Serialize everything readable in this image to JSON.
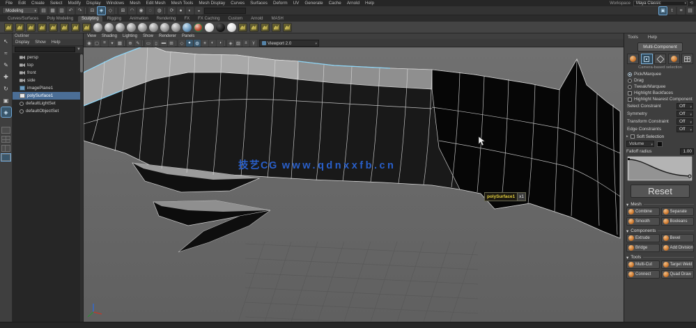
{
  "app": {
    "workspace_label": "Workspace",
    "workspace_value": "Maya Classic",
    "menu_set": "Modeling",
    "menus": [
      "File",
      "Edit",
      "Create",
      "Select",
      "Modify",
      "Display",
      "Windows",
      "Mesh",
      "Edit Mesh",
      "Mesh Tools",
      "Mesh Display",
      "Curves",
      "Surfaces",
      "Deform",
      "UV",
      "Generate",
      "Cache",
      "Arnold",
      "Help"
    ]
  },
  "statusline": {
    "icons": [
      {
        "icon_name": "new-scene-icon",
        "glyph": "▤"
      },
      {
        "icon_name": "open-scene-icon",
        "glyph": "▦"
      },
      {
        "icon_name": "save-scene-icon",
        "glyph": "▥"
      },
      {
        "icon_name": "undo-icon",
        "glyph": "↶"
      },
      {
        "icon_name": "redo-icon",
        "glyph": "↷"
      },
      {
        "type": "sep"
      },
      {
        "icon_name": "selection-mask-hierarchy-icon",
        "glyph": "⊟"
      },
      {
        "icon_name": "selection-mask-object-icon",
        "glyph": "◈",
        "active": true
      },
      {
        "icon_name": "selection-mask-component-icon",
        "glyph": "◇"
      },
      {
        "type": "sep"
      },
      {
        "icon_name": "snap-grid-icon",
        "glyph": "⊞"
      },
      {
        "icon_name": "snap-curve-icon",
        "glyph": "◠"
      },
      {
        "icon_name": "snap-point-icon",
        "glyph": "◉"
      },
      {
        "icon_name": "snap-plane-icon",
        "glyph": "◌"
      },
      {
        "icon_name": "make-live-icon",
        "glyph": "◍"
      },
      {
        "type": "sep"
      },
      {
        "icon_name": "construction-history-icon",
        "glyph": "⟳"
      },
      {
        "icon_name": "render-frame-icon",
        "glyph": "●"
      },
      {
        "icon_name": "ipr-render-icon",
        "glyph": "◐"
      },
      {
        "icon_name": "render-settings-icon",
        "glyph": "◒"
      }
    ],
    "right_icons": [
      {
        "icon_name": "modeling-toolkit-toggle-icon",
        "glyph": "▣",
        "active": true
      },
      {
        "icon_name": "character-controls-toggle-icon",
        "glyph": "t"
      },
      {
        "icon_name": "channel-box-toggle-icon",
        "glyph": "≡"
      },
      {
        "icon_name": "attribute-editor-toggle-icon",
        "glyph": "▤"
      }
    ]
  },
  "shelf": {
    "tabs": [
      {
        "label": "Curves/Surfaces"
      },
      {
        "label": "Poly Modeling"
      },
      {
        "label": "Sculpting",
        "active": true
      },
      {
        "label": "Rigging"
      },
      {
        "label": "Animation"
      },
      {
        "label": "Rendering"
      },
      {
        "label": "FX"
      },
      {
        "label": "FX Caching"
      },
      {
        "label": "Custom"
      },
      {
        "label": "Arnold"
      },
      {
        "label": "MASH"
      }
    ],
    "icons": [
      {
        "icon_name": "sculpt-tool-icon",
        "type": "yellow"
      },
      {
        "icon_name": "smooth-tool-icon",
        "type": "yellow"
      },
      {
        "icon_name": "relax-tool-icon",
        "type": "yellow"
      },
      {
        "icon_name": "grab-tool-icon",
        "type": "yellow"
      },
      {
        "icon_name": "pinch-tool-icon",
        "type": "yellow"
      },
      {
        "icon_name": "flatten-tool-icon",
        "type": "yellow"
      },
      {
        "icon_name": "foamy-tool-icon",
        "type": "yellow"
      },
      {
        "icon_name": "spray-tool-icon",
        "type": "yellow"
      },
      {
        "icon_name": "amplify-brush-icon",
        "type": "sphere"
      },
      {
        "icon_name": "bulge-brush-icon",
        "type": "sphere"
      },
      {
        "icon_name": "crease-brush-icon",
        "type": "sphere"
      },
      {
        "icon_name": "fill-brush-icon",
        "type": "sphere"
      },
      {
        "icon_name": "knife-brush-icon",
        "type": "sphere"
      },
      {
        "icon_name": "scrape-brush-icon",
        "type": "sphere"
      },
      {
        "icon_name": "smear-brush-icon",
        "type": "sphere"
      },
      {
        "icon_name": "spread-brush-icon",
        "type": "sphere"
      },
      {
        "icon_name": "freeze-brush-icon",
        "type": "sphere-blue"
      },
      {
        "icon_name": "mask-brush-icon",
        "type": "sphere-red"
      },
      {
        "icon_name": "clay-brush-icon",
        "type": "sphere-white"
      },
      {
        "icon_name": "erase-brush-icon",
        "type": "sphere-black"
      },
      {
        "icon_name": "polish-brush-icon",
        "type": "sphere-white"
      },
      {
        "icon_name": "stamp-image-icon",
        "type": "yellow"
      },
      {
        "icon_name": "imprint-tool-icon",
        "type": "yellow"
      },
      {
        "icon_name": "wax-tool-icon",
        "type": "yellow"
      },
      {
        "icon_name": "pottery-tool-icon",
        "type": "yellow"
      },
      {
        "icon_name": "update-plane-icon",
        "type": "yellow"
      }
    ]
  },
  "toolbox": {
    "tools": [
      {
        "icon_name": "select-tool-icon",
        "glyph": "↖"
      },
      {
        "icon_name": "lasso-tool-icon",
        "glyph": "≈"
      },
      {
        "icon_name": "paint-select-tool-icon",
        "glyph": "✎"
      },
      {
        "icon_name": "move-tool-icon",
        "glyph": "✚"
      },
      {
        "icon_name": "rotate-tool-icon",
        "glyph": "↻"
      },
      {
        "icon_name": "scale-tool-icon",
        "glyph": "▣"
      },
      {
        "icon_name": "last-tool-icon",
        "glyph": "◈",
        "active": true
      }
    ]
  },
  "outliner": {
    "title": "Outliner",
    "menus": [
      "Display",
      "Show",
      "Help"
    ],
    "search_placeholder": "",
    "items": [
      {
        "label": "persp",
        "icon": "camera"
      },
      {
        "label": "top",
        "icon": "camera"
      },
      {
        "label": "front",
        "icon": "camera"
      },
      {
        "label": "side",
        "icon": "camera"
      },
      {
        "label": "imagePlane1",
        "icon": "plane"
      },
      {
        "label": "polySurface1",
        "icon": "mesh",
        "selected": true
      },
      {
        "label": "defaultLightSet",
        "icon": "set"
      },
      {
        "label": "defaultObjectSet",
        "icon": "set"
      }
    ]
  },
  "viewport": {
    "menus": [
      "View",
      "Shading",
      "Lighting",
      "Show",
      "Renderer",
      "Panels"
    ],
    "icons": [
      {
        "icon_name": "select-camera-icon",
        "glyph": "◉"
      },
      {
        "icon_name": "lock-camera-icon",
        "glyph": "▢"
      },
      {
        "icon_name": "camera-attributes-icon",
        "glyph": "≡"
      },
      {
        "icon_name": "bookmarks-icon",
        "glyph": "▾"
      },
      {
        "icon_name": "image-plane-icon",
        "glyph": "▦"
      },
      {
        "type": "sep"
      },
      {
        "icon_name": "pan-zoom-icon",
        "glyph": "⊕"
      },
      {
        "icon_name": "grease-pencil-icon",
        "glyph": "✎"
      },
      {
        "type": "sep"
      },
      {
        "icon_name": "film-gate-icon",
        "glyph": "▭"
      },
      {
        "icon_name": "resolution-gate-icon",
        "glyph": "▯"
      },
      {
        "icon_name": "gate-mask-icon",
        "glyph": "▬"
      },
      {
        "icon_name": "field-chart-icon",
        "glyph": "⊞"
      },
      {
        "type": "sep"
      },
      {
        "icon_name": "wireframe-icon",
        "glyph": "◇"
      },
      {
        "icon_name": "smooth-shade-icon",
        "glyph": "●",
        "active": true
      },
      {
        "icon_name": "textured-icon",
        "glyph": "◍",
        "active": true
      },
      {
        "icon_name": "lights-icon",
        "glyph": "☀"
      },
      {
        "icon_name": "shadows-icon",
        "glyph": "◐"
      },
      {
        "icon_name": "occlusion-icon",
        "glyph": "◑"
      },
      {
        "type": "sep"
      },
      {
        "icon_name": "isolate-select-icon",
        "glyph": "◈"
      },
      {
        "icon_name": "xray-icon",
        "glyph": "▨"
      },
      {
        "icon_name": "exposure-icon",
        "glyph": "±"
      },
      {
        "icon_name": "gamma-icon",
        "glyph": "γ"
      }
    ],
    "renderer_value": "Viewport 2.0",
    "watermark_cn": "技艺CG",
    "watermark_url": "www.qdnxxfb.cn",
    "tooltip_text": "polySurface1",
    "tooltip_badge": "x1"
  },
  "toolkit": {
    "menus": [
      "Tools",
      "Help"
    ],
    "multi_component_label": "Multi-Component",
    "selection_caption": "Camera-based selection",
    "radios": [
      {
        "label": "Pick/Marquee",
        "selected": true
      },
      {
        "label": "Drag"
      },
      {
        "label": "Tweak/Marquee"
      }
    ],
    "checkboxes": [
      {
        "label": "Highlight Backfaces",
        "checked": true
      },
      {
        "label": "Highlight Nearest Component",
        "checked": true
      }
    ],
    "dropdown_rows": [
      {
        "label": "Select Constraint",
        "value": "Off"
      },
      {
        "label": "Symmetry",
        "value": "Off"
      },
      {
        "label": "Transform Constraint",
        "value": "Off"
      },
      {
        "label": "Edge Constraints",
        "value": "Off"
      }
    ],
    "soft_selection": {
      "title": "Soft Selection",
      "mode_value": "Volume",
      "falloff_label": "Falloff radius",
      "falloff_value": "1.00",
      "reset_label": "Reset"
    },
    "sections": {
      "mesh_title": "Mesh",
      "components_title": "Components",
      "tools_title": "Tools",
      "mesh_buttons": [
        {
          "label": "Combine"
        },
        {
          "label": "Separate"
        },
        {
          "label": "Smooth"
        },
        {
          "label": "Booleans"
        }
      ],
      "component_buttons": [
        {
          "label": "Extrude"
        },
        {
          "label": "Bevel"
        },
        {
          "label": "Bridge"
        },
        {
          "label": "Add Divisions"
        }
      ],
      "tool_buttons": [
        {
          "label": "Multi-Cut"
        },
        {
          "label": "Target Weld"
        },
        {
          "label": "Connect"
        },
        {
          "label": "Quad Draw"
        }
      ]
    }
  },
  "colors": {
    "accent_blue": "#5a8fb4",
    "selection_blue": "#4b6e96",
    "icon_orange": "#cf7a30",
    "watermark_blue": "#2b66d9",
    "wireframe": "#d8d8d8",
    "selected_edge": "#8ed6f7"
  }
}
